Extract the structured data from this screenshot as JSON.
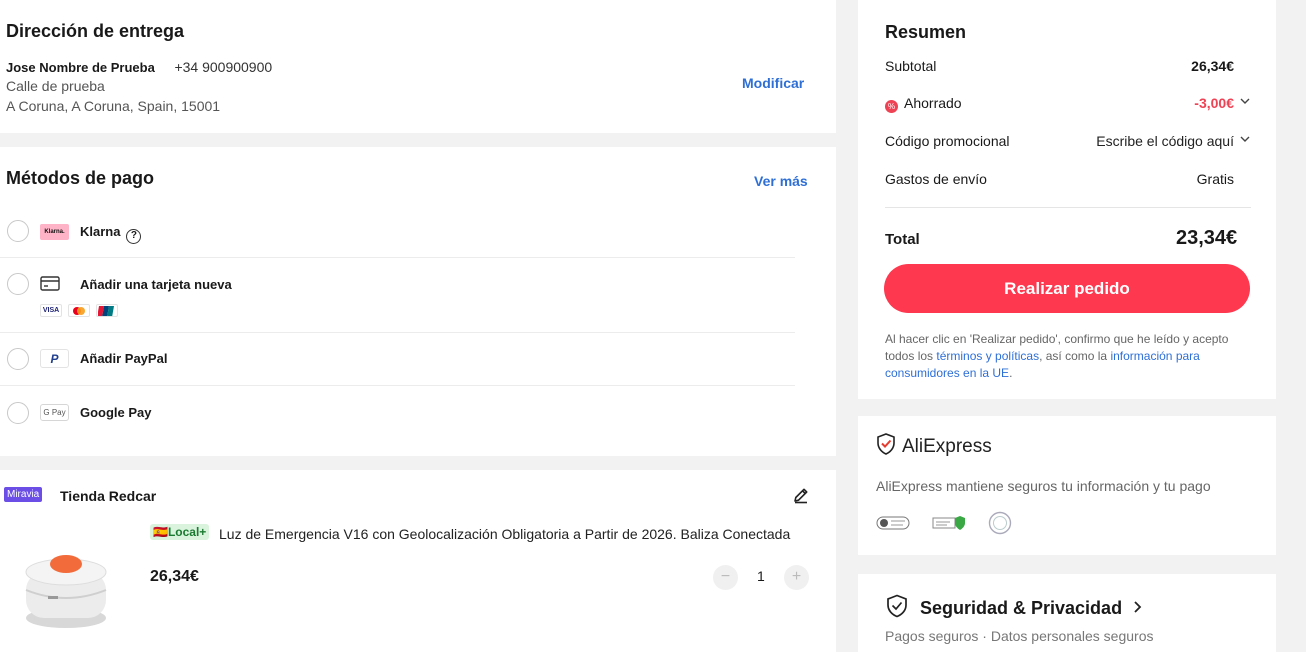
{
  "address": {
    "title": "Dirección de entrega",
    "name": "Jose Nombre de Prueba",
    "phone": "+34 900900900",
    "street": "Calle de prueba",
    "city": "A Coruna, A Coruna, Spain, 15001",
    "edit_label": "Modificar"
  },
  "payment": {
    "title": "Métodos de pago",
    "more_label": "Ver más",
    "methods": [
      {
        "label": "Klarna",
        "logo": "Klarna."
      },
      {
        "label": "Añadir una tarjeta nueva",
        "cards": [
          "VISA",
          "MC",
          "UP"
        ]
      },
      {
        "label": "Añadir PayPal",
        "logo": "P"
      },
      {
        "label": "Google Pay",
        "logo": "G Pay"
      }
    ]
  },
  "store": {
    "badge": "Miravia",
    "name": "Tienda Redcar",
    "local_badge": "🇪🇸Local+",
    "product_title": "Luz de Emergencia V16 con Geolocalización Obligatoria a Partir de 2026. Baliza Conectada",
    "price": "26,34€",
    "quantity": "1",
    "minus": "−",
    "plus": "+"
  },
  "summary": {
    "title": "Resumen",
    "subtotal_label": "Subtotal",
    "subtotal_value": "26,34€",
    "saved_label": "Ahorrado",
    "saved_value": "-3,00€",
    "promo_label": "Código promocional",
    "promo_value": "Escribe el código aquí",
    "shipping_label": "Gastos de envío",
    "shipping_value": "Gratis",
    "total_label": "Total",
    "total_value": "23,34€",
    "order_button": "Realizar pedido",
    "legal_pre": "Al hacer clic en 'Realizar pedido', confirmo que he leído y acepto todos los ",
    "legal_link1": "términos y políticas",
    "legal_mid": ", así como la ",
    "legal_link2": "información para consumidores en la UE",
    "legal_end": "."
  },
  "trust": {
    "brand": "AliExpress",
    "description": "AliExpress mantiene seguros tu información y tu pago"
  },
  "security": {
    "title": "Seguridad & Privacidad",
    "subtitle": "Pagos seguros · Datos personales seguros"
  },
  "colors": {
    "accent": "#fd384f",
    "link": "#2e6fd6",
    "discount": "#ee4255"
  }
}
